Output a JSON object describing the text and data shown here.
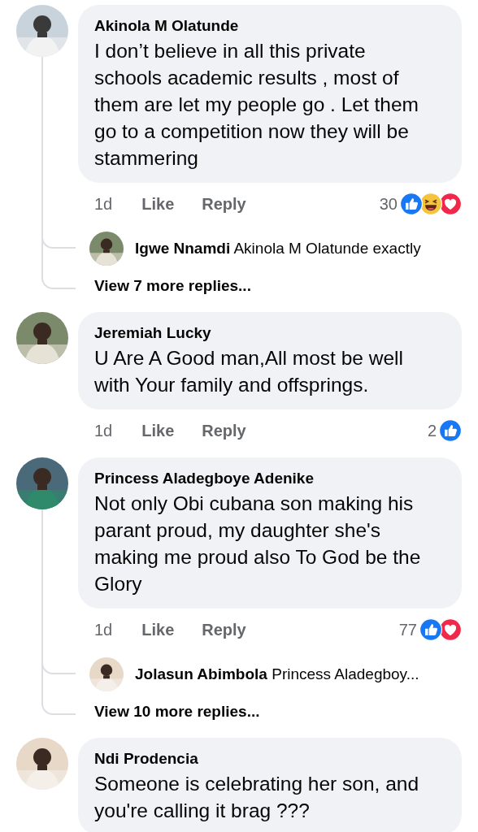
{
  "comments": [
    {
      "author": "Akinola M Olatunde",
      "text": "I don’t believe in all this private schools academic results , most of them are let my people go . Let them go to a competition now they will be stammering",
      "time": "1d",
      "like": "Like",
      "reply": "Reply",
      "reaction_count": "30",
      "reactions": [
        {
          "kind": "like"
        },
        {
          "kind": "haha"
        },
        {
          "kind": "love"
        }
      ],
      "replies": [
        {
          "author": "Igwe Nnamdi",
          "text": "Akinola M Olatunde exactly"
        }
      ],
      "more_replies": "View 7 more replies..."
    },
    {
      "author": "Jeremiah Lucky",
      "text": "U Are A Good man,All most be well with Your family and offsprings.",
      "time": "1d",
      "like": "Like",
      "reply": "Reply",
      "reaction_count": "2",
      "reactions": [
        {
          "kind": "like"
        }
      ]
    },
    {
      "author": "Princess Aladegboye Adenike",
      "text": "Not only Obi cubana son making his parant proud, my daughter she's making me proud also To God be the Glory",
      "time": "1d",
      "like": "Like",
      "reply": "Reply",
      "reaction_count": "77",
      "reactions": [
        {
          "kind": "like"
        },
        {
          "kind": "love"
        }
      ],
      "replies": [
        {
          "author": "Jolasun Abimbola",
          "text": "Princess Aladegboy..."
        }
      ],
      "more_replies": "View 10 more replies..."
    },
    {
      "author": "Ndi Prodencia",
      "text": "Someone is celebrating her son, and you're calling it brag ???"
    }
  ]
}
